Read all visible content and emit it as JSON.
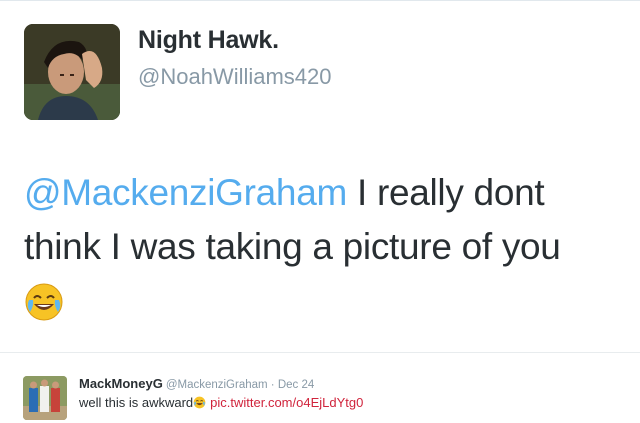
{
  "tweet": {
    "display_name": "Night Hawk.",
    "handle": "@NoahWilliams420",
    "mention": "@MackenziGraham",
    "text": " I really dont think I was taking a picture of you",
    "emoji": "face-with-tears-of-joy"
  },
  "quoted_tweet": {
    "display_name": "MackMoneyG",
    "handle": "@MackenziGraham",
    "separator": " · ",
    "date": "Dec 24",
    "text": "well this is awkward",
    "emoji": "face-with-tears-of-joy",
    "link": "pic.twitter.com/o4EjLdYtg0"
  },
  "colors": {
    "mention": "#55acee",
    "handle": "#8899a6",
    "link": "#d0243c",
    "text": "#292f33"
  }
}
